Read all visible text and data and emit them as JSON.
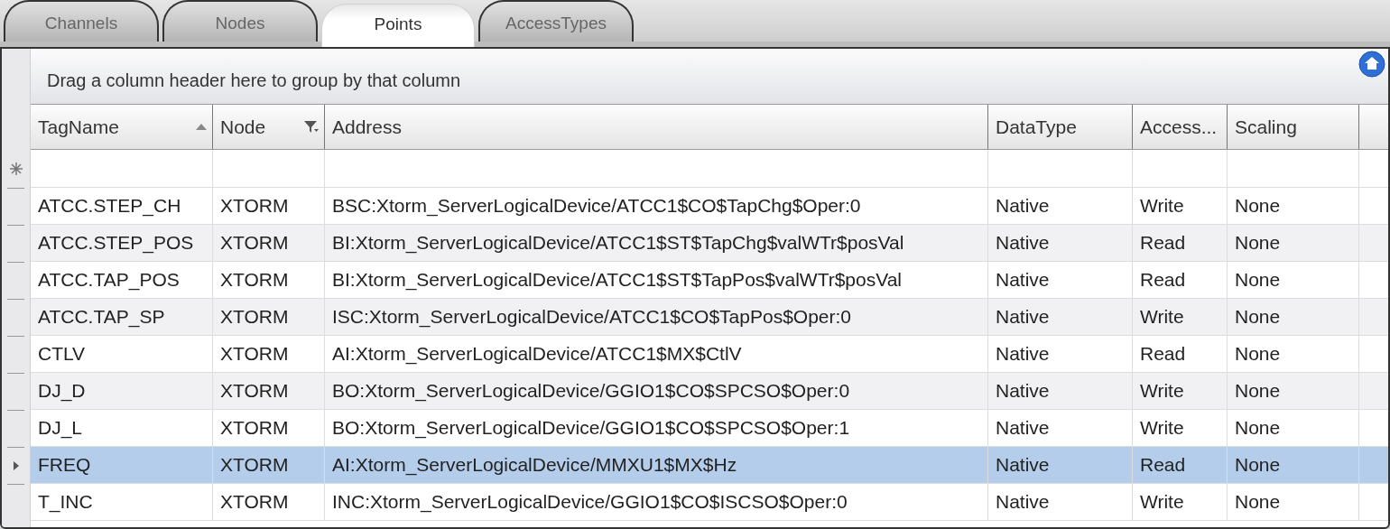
{
  "tabs": [
    {
      "label": "Channels",
      "selected": false
    },
    {
      "label": "Nodes",
      "selected": false
    },
    {
      "label": "Points",
      "selected": true
    },
    {
      "label": "AccessTypes",
      "selected": false
    }
  ],
  "group_panel": {
    "hint": "Drag a column header here to group by that column"
  },
  "table": {
    "columns": [
      {
        "label": "TagName",
        "sorted": true,
        "filter": false
      },
      {
        "label": "Node",
        "sorted": false,
        "filter": true
      },
      {
        "label": "Address",
        "sorted": false,
        "filter": false
      },
      {
        "label": "DataType",
        "sorted": false,
        "filter": false
      },
      {
        "label": "Access...",
        "sorted": false,
        "filter": false
      },
      {
        "label": "Scaling",
        "sorted": false,
        "filter": false
      }
    ],
    "rows": [
      {
        "cells": [
          "ATCC.STEP_CH",
          "XTORM",
          "BSC:Xtorm_ServerLogicalDevice/ATCC1$CO$TapChg$Oper:0",
          "Native",
          "Write",
          "None"
        ],
        "selected": false
      },
      {
        "cells": [
          "ATCC.STEP_POS",
          "XTORM",
          "BI:Xtorm_ServerLogicalDevice/ATCC1$ST$TapChg$valWTr$posVal",
          "Native",
          "Read",
          "None"
        ],
        "selected": false
      },
      {
        "cells": [
          "ATCC.TAP_POS",
          "XTORM",
          "BI:Xtorm_ServerLogicalDevice/ATCC1$ST$TapPos$valWTr$posVal",
          "Native",
          "Read",
          "None"
        ],
        "selected": false
      },
      {
        "cells": [
          "ATCC.TAP_SP",
          "XTORM",
          "ISC:Xtorm_ServerLogicalDevice/ATCC1$CO$TapPos$Oper:0",
          "Native",
          "Write",
          "None"
        ],
        "selected": false
      },
      {
        "cells": [
          "CTLV",
          "XTORM",
          "AI:Xtorm_ServerLogicalDevice/ATCC1$MX$CtlV",
          "Native",
          "Read",
          "None"
        ],
        "selected": false
      },
      {
        "cells": [
          "DJ_D",
          "XTORM",
          "BO:Xtorm_ServerLogicalDevice/GGIO1$CO$SPCSO$Oper:0",
          "Native",
          "Write",
          "None"
        ],
        "selected": false
      },
      {
        "cells": [
          "DJ_L",
          "XTORM",
          "BO:Xtorm_ServerLogicalDevice/GGIO1$CO$SPCSO$Oper:1",
          "Native",
          "Write",
          "None"
        ],
        "selected": false
      },
      {
        "cells": [
          "FREQ",
          "XTORM",
          "AI:Xtorm_ServerLogicalDevice/MMXU1$MX$Hz",
          "Native",
          "Read",
          "None"
        ],
        "selected": true
      },
      {
        "cells": [
          "T_INC",
          "XTORM",
          "INC:Xtorm_ServerLogicalDevice/GGIO1$CO$ISCSO$Oper:0",
          "Native",
          "Write",
          "None"
        ],
        "selected": false
      }
    ]
  }
}
